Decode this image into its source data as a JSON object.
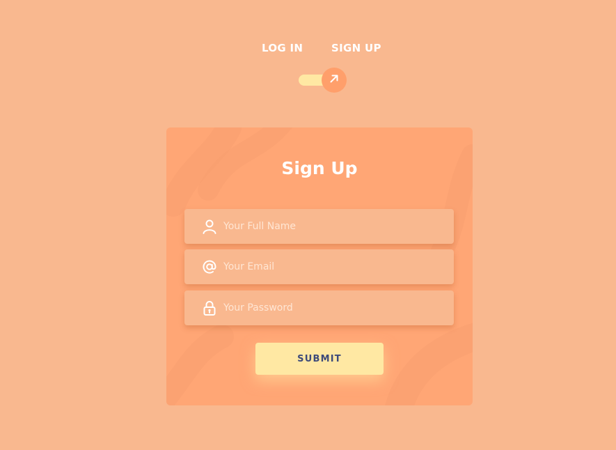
{
  "tabs": {
    "login_label": "LOG IN",
    "signup_label": "SIGN UP"
  },
  "toggle": {
    "icon": "arrow-up-right-icon",
    "active_side": "signup"
  },
  "form": {
    "title": "Sign Up",
    "fields": [
      {
        "icon": "user-icon",
        "placeholder": "Your Full Name",
        "value": ""
      },
      {
        "icon": "at-sign-icon",
        "placeholder": "Your Email",
        "value": ""
      },
      {
        "icon": "lock-icon",
        "placeholder": "Your Password",
        "value": ""
      }
    ],
    "submit_label": "SUBMIT"
  },
  "colors": {
    "page_background": "#f9b88f",
    "card_background": "#ffa675",
    "accent": "#ffe8a3",
    "knob": "#ff9f6b",
    "submit_text": "#3d4a7a"
  }
}
